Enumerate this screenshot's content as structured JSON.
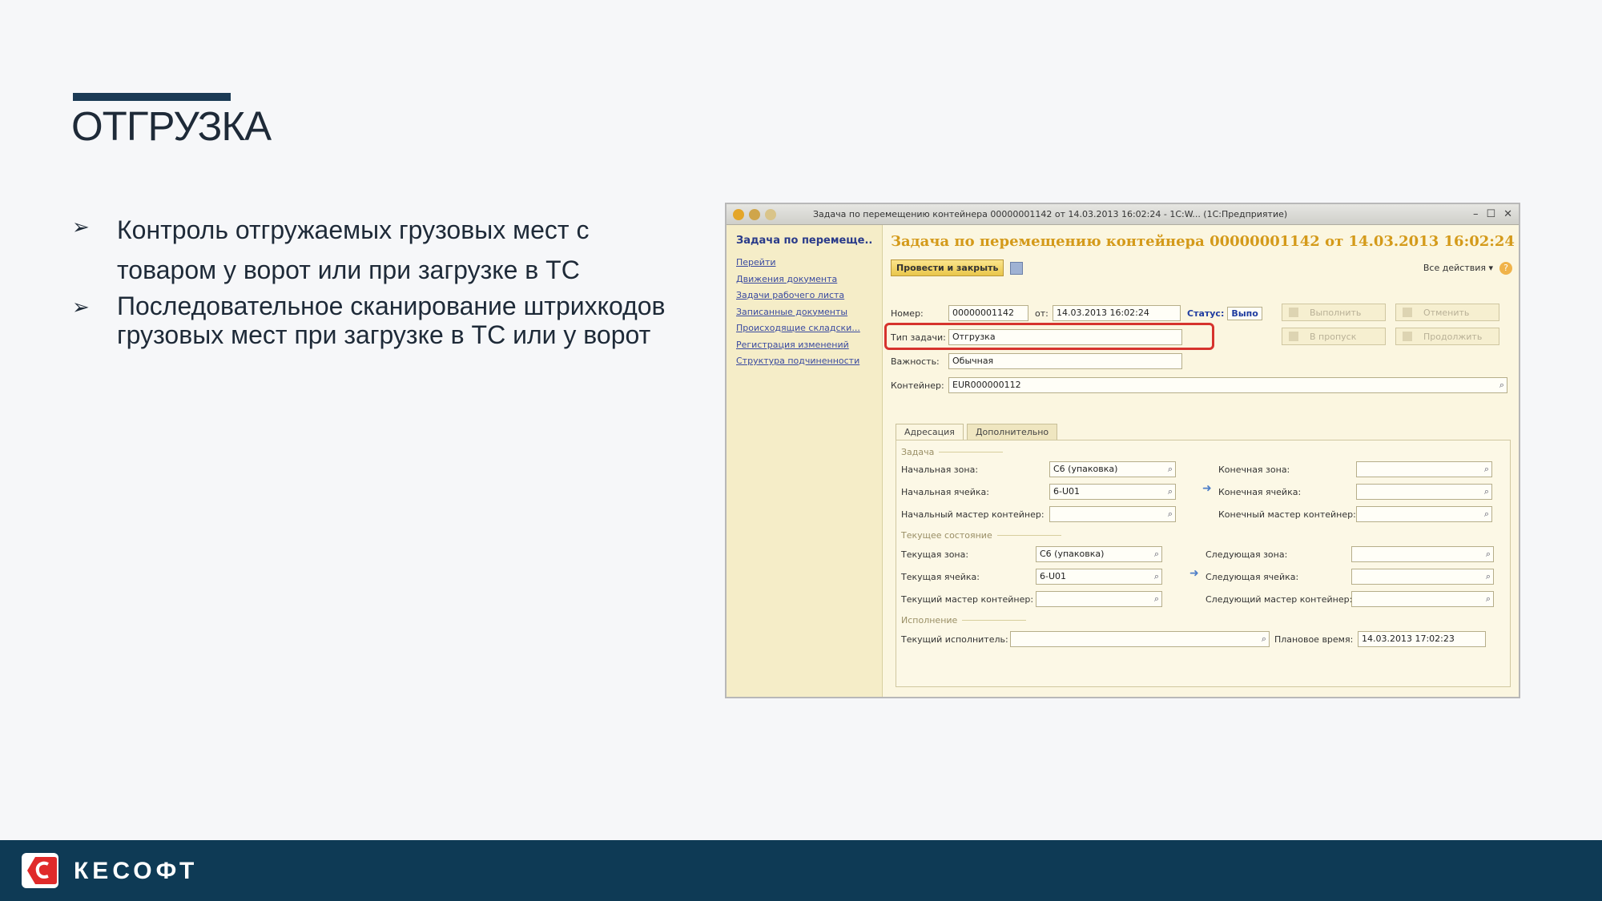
{
  "slide": {
    "title": "ОТГРУЗКА",
    "bullets": [
      "Контроль отгружаемых грузовых мест с товаром у ворот или при загрузке в ТС",
      "Последовательное сканирование штрихкодов грузовых мест при загрузке в ТС или у ворот"
    ],
    "bullet_mark": "➢",
    "brand": "КЕСОФТ",
    "colors": {
      "accent": "#1b3a55",
      "footer": "#0e3a55",
      "logo_red": "#e02a2a"
    }
  },
  "window": {
    "title": "Задача по перемещению контейнера 00000001142 от 14.03.2013 16:02:24 - 1С:W...  (1С:Предприятие)",
    "nav": {
      "header": "Задача по перемеще...",
      "items": [
        "Перейти",
        "Движения документа",
        "Задачи рабочего листа",
        "Записанные документы",
        "Происходящие складски...",
        "Регистрация изменений",
        "Структура подчиненности"
      ]
    },
    "doc_title": "Задача по перемещению контейнера 00000001142 от 14.03.2013 16:02:24",
    "toolbar": {
      "post_close": "Провести и закрыть",
      "all_actions": "Все действия ▾"
    },
    "header_fields": {
      "number_label": "Номер:",
      "number": "00000001142",
      "date_label": "от:",
      "date": "14.03.2013 16:02:24",
      "status_label": "Статус:",
      "status": "Выпо",
      "task_type_label": "Тип задачи:",
      "task_type": "Отгрузка",
      "priority_label": "Важность:",
      "priority": "Обычная",
      "container_label": "Контейнер:",
      "container": "EUR000000112"
    },
    "action_buttons": [
      "Выполнить",
      "Отменить",
      "В пропуск",
      "Продолжить"
    ],
    "tabs": [
      "Адресация",
      "Дополнительно"
    ],
    "task_group": {
      "title": "Задача",
      "start_zone_label": "Начальная зона:",
      "start_zone": "С6 (упаковка)",
      "start_cell_label": "Начальная ячейка:",
      "start_cell": "6-U01",
      "start_master_label": "Начальный мастер контейнер:",
      "start_master": "",
      "end_zone_label": "Конечная зона:",
      "end_zone": "",
      "end_cell_label": "Конечная ячейка:",
      "end_cell": "",
      "end_master_label": "Конечный мастер контейнер:",
      "end_master": ""
    },
    "current_group": {
      "title": "Текущее состояние",
      "cur_zone_label": "Текущая зона:",
      "cur_zone": "С6 (упаковка)",
      "cur_cell_label": "Текущая ячейка:",
      "cur_cell": "6-U01",
      "cur_master_label": "Текущий мастер контейнер:",
      "cur_master": "",
      "next_zone_label": "Следующая зона:",
      "next_zone": "",
      "next_cell_label": "Следующая ячейка:",
      "next_cell": "",
      "next_master_label": "Следующий мастер контейнер:",
      "next_master": ""
    },
    "exec_group": {
      "title": "Исполнение",
      "executor_label": "Текущий исполнитель:",
      "executor": "",
      "planned_label": "Плановое время:",
      "planned": "14.03.2013 17:02:23"
    }
  }
}
